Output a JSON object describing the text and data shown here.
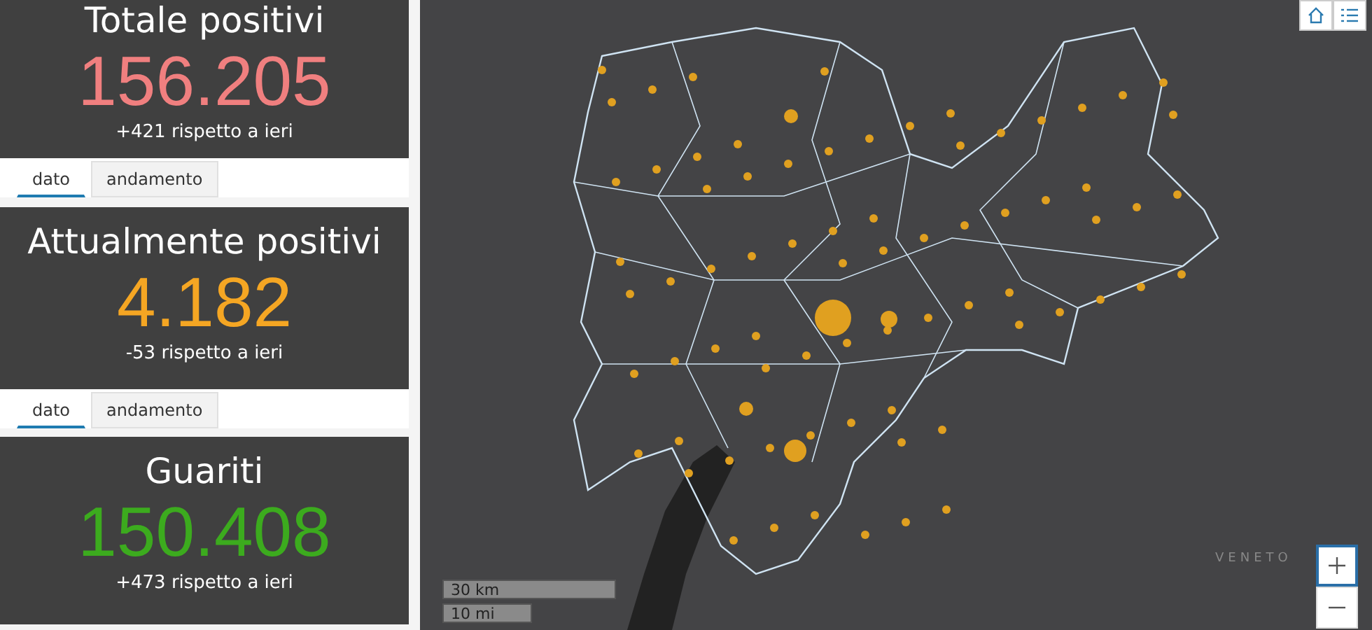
{
  "cards": [
    {
      "title": "Totale positivi",
      "value": "156.205",
      "color": "#f07f7f",
      "delta": "+421 rispetto a ieri",
      "tabs": [
        {
          "label": "dato",
          "selected": true
        },
        {
          "label": "andamento",
          "selected": false
        }
      ]
    },
    {
      "title": "Attualmente positivi",
      "value": "4.182",
      "color": "#f5a623",
      "delta": "-53 rispetto a ieri",
      "tabs": [
        {
          "label": "dato",
          "selected": true
        },
        {
          "label": "andamento",
          "selected": false
        }
      ]
    },
    {
      "title": "Guariti",
      "value": "150.408",
      "color": "#3cab1e",
      "delta": "+473 rispetto a ieri"
    }
  ],
  "map": {
    "region_label": "VENETO",
    "scale": [
      "30 km",
      "10 mi"
    ]
  }
}
